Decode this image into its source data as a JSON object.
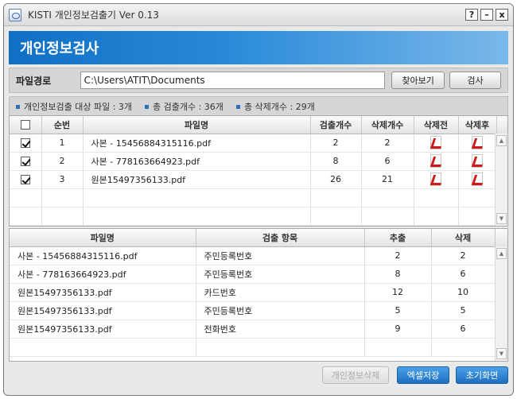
{
  "window": {
    "title": "KISTI 개인정보검출기 Ver 0.13",
    "controls": [
      "?",
      "–",
      "x"
    ]
  },
  "banner": {
    "title": "개인정보검사"
  },
  "path": {
    "label": "파일경로",
    "value": "C:\\Users\\ATIT\\Documents",
    "browse_label": "찾아보기",
    "scan_label": "검사"
  },
  "summary": [
    "개인정보검출 대상 파일 : 3개",
    "총 검출개수 : 36개",
    "총 삭제개수 : 29개"
  ],
  "files_table": {
    "headers": [
      "",
      "순번",
      "파일명",
      "검출개수",
      "삭제개수",
      "삭제전",
      "삭제후"
    ],
    "rows": [
      {
        "checked": true,
        "num": "1",
        "name": "사본 - 15456884315116.pdf",
        "found": "2",
        "deleted": "2"
      },
      {
        "checked": true,
        "num": "2",
        "name": "사본 - 778163664923.pdf",
        "found": "8",
        "deleted": "6"
      },
      {
        "checked": true,
        "num": "3",
        "name": "원본15497356133.pdf",
        "found": "26",
        "deleted": "21"
      }
    ]
  },
  "detail_table": {
    "headers": [
      "파일명",
      "검출 항목",
      "추출",
      "삭제"
    ],
    "rows": [
      {
        "name": "사본 - 15456884315116.pdf",
        "item": "주민등록번호",
        "extracted": "2",
        "deleted": "2"
      },
      {
        "name": "사본 - 778163664923.pdf",
        "item": "주민등록번호",
        "extracted": "8",
        "deleted": "6"
      },
      {
        "name": "원본15497356133.pdf",
        "item": "카드번호",
        "extracted": "12",
        "deleted": "10"
      },
      {
        "name": "원본15497356133.pdf",
        "item": "주민등록번호",
        "extracted": "5",
        "deleted": "5"
      },
      {
        "name": "원본15497356133.pdf",
        "item": "전화번호",
        "extracted": "9",
        "deleted": "6"
      }
    ]
  },
  "footer": {
    "disabled_label": "개인정보삭제",
    "excel_label": "엑셀저장",
    "reset_label": "초기화면"
  },
  "icons": {
    "pdf": "pdf-file-icon",
    "checkbox": "checkbox-icon"
  },
  "colors": {
    "banner": "#0f6fc4",
    "accent_button": "#1e6fc0",
    "pdf_red": "#d01818"
  }
}
